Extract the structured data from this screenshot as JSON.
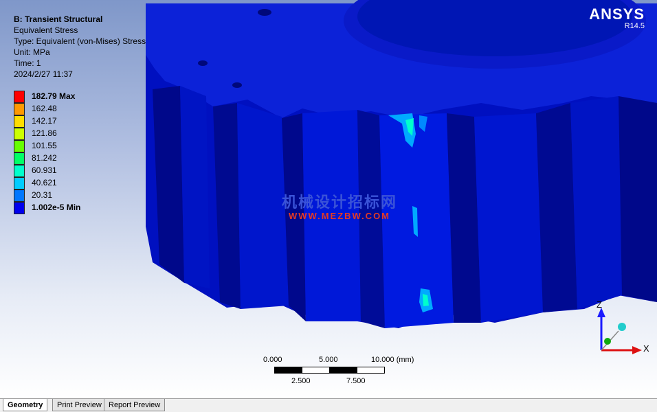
{
  "result": {
    "title": "B: Transient Structural",
    "name": "Equivalent Stress",
    "type": "Type: Equivalent (von-Mises) Stress",
    "unit": "Unit: MPa",
    "time": "Time: 1",
    "date": "2024/2/27 11:37"
  },
  "legend": {
    "entries": [
      {
        "label": "182.79 Max",
        "color": "#ff0000",
        "bold": true
      },
      {
        "label": "162.48",
        "color": "#ff9900",
        "bold": false
      },
      {
        "label": "142.17",
        "color": "#ffdd00",
        "bold": false
      },
      {
        "label": "121.86",
        "color": "#ccff00",
        "bold": false
      },
      {
        "label": "101.55",
        "color": "#66ff00",
        "bold": false
      },
      {
        "label": "81.242",
        "color": "#00ff66",
        "bold": false
      },
      {
        "label": "60.931",
        "color": "#00ffcc",
        "bold": false
      },
      {
        "label": "40.621",
        "color": "#00ccff",
        "bold": false
      },
      {
        "label": "20.31",
        "color": "#0077ff",
        "bold": false
      },
      {
        "label": "1.002e-5 Min",
        "color": "#0000ee",
        "bold": true
      }
    ]
  },
  "brand": {
    "name": "ANSYS",
    "version": "R14.5"
  },
  "watermark": {
    "text": "机械设计招标网",
    "url": "WWW.MEZBW.COM"
  },
  "scale": {
    "top_labels": [
      "0.000",
      "5.000",
      "10.000 (mm)"
    ],
    "bottom_labels": [
      "2.500",
      "7.500"
    ]
  },
  "triad": {
    "x": "X",
    "z": "Z"
  },
  "colors": {
    "model_dark": "#000a8c",
    "model_mid": "#0010c8",
    "model_light": "#0018e8"
  },
  "tabs": [
    {
      "label": "Geometry",
      "active": true
    },
    {
      "label": "Print Preview",
      "active": false
    },
    {
      "label": "Report Preview",
      "active": false
    }
  ]
}
